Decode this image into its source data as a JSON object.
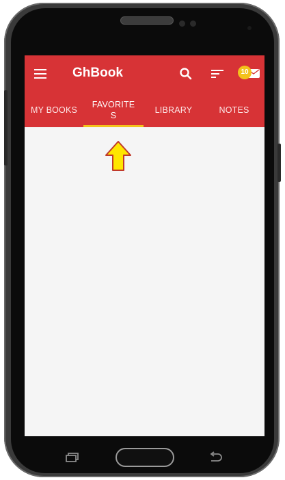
{
  "app": {
    "title": "GhBook",
    "notification_count": "10"
  },
  "tabs": [
    {
      "label": "MY BOOKS",
      "active": false
    },
    {
      "label": "FAVORITES",
      "active": true
    },
    {
      "label": "LIBRARY",
      "active": false
    },
    {
      "label": "NOTES",
      "active": false
    }
  ],
  "colors": {
    "appbar": "#d73336",
    "indicator": "#f3c21b",
    "arrow_fill": "#ffe600",
    "arrow_stroke": "#c0392b",
    "content_bg": "#f5f5f5"
  },
  "icons": {
    "menu": "hamburger-menu-icon",
    "search": "search-icon",
    "sort": "sort-icon",
    "notifications": "mail-icon",
    "recent": "recent-apps-icon",
    "back": "back-icon"
  }
}
